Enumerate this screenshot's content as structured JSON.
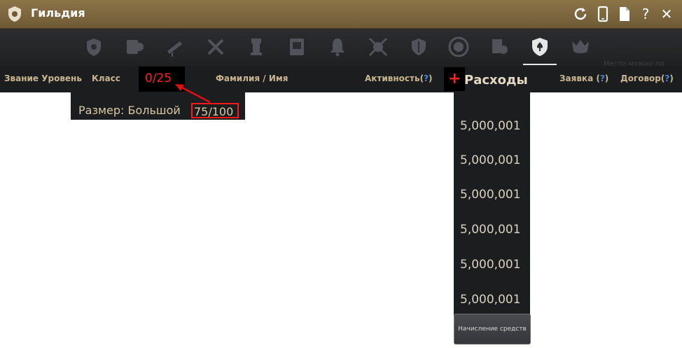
{
  "window": {
    "title": "Гильдия"
  },
  "tabs": [
    {
      "icon": "guild-emblem-icon"
    },
    {
      "icon": "member-scroll-icon"
    },
    {
      "icon": "telescope-icon"
    },
    {
      "icon": "crossed-tools-icon"
    },
    {
      "icon": "tower-icon"
    },
    {
      "icon": "notice-board-icon"
    },
    {
      "icon": "bell-icon"
    },
    {
      "icon": "crossed-axes-icon"
    },
    {
      "icon": "shield-sword-icon"
    },
    {
      "icon": "medal-icon"
    },
    {
      "icon": "document-icon"
    },
    {
      "icon": "fleur-de-lis-shield-icon",
      "active": true
    },
    {
      "icon": "jester-mask-icon"
    }
  ],
  "background_hint": "Место можно по карте",
  "header": {
    "rank_level": "Звание Уровень",
    "class": "Класс",
    "name": "Фамилия / Имя",
    "activity": "Активность(",
    "activity_q": "?",
    "activity_close": ")",
    "request": "Заявка (",
    "request_q": "?",
    "request_close": ")",
    "contract": "Договор(",
    "contract_q": "?",
    "contract_close": ")"
  },
  "member_count": "0/25",
  "size": {
    "label": "Размер: Большой",
    "value": "75/100"
  },
  "expenses": {
    "title": "Расходы",
    "plus": "+",
    "values": [
      "5,000,001",
      "5,000,001",
      "5,000,001",
      "5,000,001",
      "5,000,001",
      "5,000,001"
    ]
  },
  "deposit_button": "Начисление средств",
  "colors": {
    "accent_red": "#ff1f1f",
    "titlebar": "#7d6740",
    "panel": "#1c1d1f",
    "question": "#3b8be8"
  }
}
